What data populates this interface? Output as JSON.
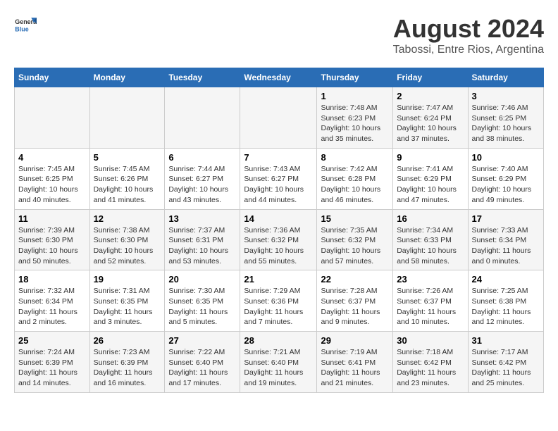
{
  "header": {
    "logo_general": "General",
    "logo_blue": "Blue",
    "main_title": "August 2024",
    "subtitle": "Tabossi, Entre Rios, Argentina"
  },
  "calendar": {
    "days_of_week": [
      "Sunday",
      "Monday",
      "Tuesday",
      "Wednesday",
      "Thursday",
      "Friday",
      "Saturday"
    ],
    "weeks": [
      [
        {
          "day": "",
          "info": ""
        },
        {
          "day": "",
          "info": ""
        },
        {
          "day": "",
          "info": ""
        },
        {
          "day": "",
          "info": ""
        },
        {
          "day": "1",
          "info": "Sunrise: 7:48 AM\nSunset: 6:23 PM\nDaylight: 10 hours\nand 35 minutes."
        },
        {
          "day": "2",
          "info": "Sunrise: 7:47 AM\nSunset: 6:24 PM\nDaylight: 10 hours\nand 37 minutes."
        },
        {
          "day": "3",
          "info": "Sunrise: 7:46 AM\nSunset: 6:25 PM\nDaylight: 10 hours\nand 38 minutes."
        }
      ],
      [
        {
          "day": "4",
          "info": "Sunrise: 7:45 AM\nSunset: 6:25 PM\nDaylight: 10 hours\nand 40 minutes."
        },
        {
          "day": "5",
          "info": "Sunrise: 7:45 AM\nSunset: 6:26 PM\nDaylight: 10 hours\nand 41 minutes."
        },
        {
          "day": "6",
          "info": "Sunrise: 7:44 AM\nSunset: 6:27 PM\nDaylight: 10 hours\nand 43 minutes."
        },
        {
          "day": "7",
          "info": "Sunrise: 7:43 AM\nSunset: 6:27 PM\nDaylight: 10 hours\nand 44 minutes."
        },
        {
          "day": "8",
          "info": "Sunrise: 7:42 AM\nSunset: 6:28 PM\nDaylight: 10 hours\nand 46 minutes."
        },
        {
          "day": "9",
          "info": "Sunrise: 7:41 AM\nSunset: 6:29 PM\nDaylight: 10 hours\nand 47 minutes."
        },
        {
          "day": "10",
          "info": "Sunrise: 7:40 AM\nSunset: 6:29 PM\nDaylight: 10 hours\nand 49 minutes."
        }
      ],
      [
        {
          "day": "11",
          "info": "Sunrise: 7:39 AM\nSunset: 6:30 PM\nDaylight: 10 hours\nand 50 minutes."
        },
        {
          "day": "12",
          "info": "Sunrise: 7:38 AM\nSunset: 6:30 PM\nDaylight: 10 hours\nand 52 minutes."
        },
        {
          "day": "13",
          "info": "Sunrise: 7:37 AM\nSunset: 6:31 PM\nDaylight: 10 hours\nand 53 minutes."
        },
        {
          "day": "14",
          "info": "Sunrise: 7:36 AM\nSunset: 6:32 PM\nDaylight: 10 hours\nand 55 minutes."
        },
        {
          "day": "15",
          "info": "Sunrise: 7:35 AM\nSunset: 6:32 PM\nDaylight: 10 hours\nand 57 minutes."
        },
        {
          "day": "16",
          "info": "Sunrise: 7:34 AM\nSunset: 6:33 PM\nDaylight: 10 hours\nand 58 minutes."
        },
        {
          "day": "17",
          "info": "Sunrise: 7:33 AM\nSunset: 6:34 PM\nDaylight: 11 hours\nand 0 minutes."
        }
      ],
      [
        {
          "day": "18",
          "info": "Sunrise: 7:32 AM\nSunset: 6:34 PM\nDaylight: 11 hours\nand 2 minutes."
        },
        {
          "day": "19",
          "info": "Sunrise: 7:31 AM\nSunset: 6:35 PM\nDaylight: 11 hours\nand 3 minutes."
        },
        {
          "day": "20",
          "info": "Sunrise: 7:30 AM\nSunset: 6:35 PM\nDaylight: 11 hours\nand 5 minutes."
        },
        {
          "day": "21",
          "info": "Sunrise: 7:29 AM\nSunset: 6:36 PM\nDaylight: 11 hours\nand 7 minutes."
        },
        {
          "day": "22",
          "info": "Sunrise: 7:28 AM\nSunset: 6:37 PM\nDaylight: 11 hours\nand 9 minutes."
        },
        {
          "day": "23",
          "info": "Sunrise: 7:26 AM\nSunset: 6:37 PM\nDaylight: 11 hours\nand 10 minutes."
        },
        {
          "day": "24",
          "info": "Sunrise: 7:25 AM\nSunset: 6:38 PM\nDaylight: 11 hours\nand 12 minutes."
        }
      ],
      [
        {
          "day": "25",
          "info": "Sunrise: 7:24 AM\nSunset: 6:39 PM\nDaylight: 11 hours\nand 14 minutes."
        },
        {
          "day": "26",
          "info": "Sunrise: 7:23 AM\nSunset: 6:39 PM\nDaylight: 11 hours\nand 16 minutes."
        },
        {
          "day": "27",
          "info": "Sunrise: 7:22 AM\nSunset: 6:40 PM\nDaylight: 11 hours\nand 17 minutes."
        },
        {
          "day": "28",
          "info": "Sunrise: 7:21 AM\nSunset: 6:40 PM\nDaylight: 11 hours\nand 19 minutes."
        },
        {
          "day": "29",
          "info": "Sunrise: 7:19 AM\nSunset: 6:41 PM\nDaylight: 11 hours\nand 21 minutes."
        },
        {
          "day": "30",
          "info": "Sunrise: 7:18 AM\nSunset: 6:42 PM\nDaylight: 11 hours\nand 23 minutes."
        },
        {
          "day": "31",
          "info": "Sunrise: 7:17 AM\nSunset: 6:42 PM\nDaylight: 11 hours\nand 25 minutes."
        }
      ]
    ]
  }
}
